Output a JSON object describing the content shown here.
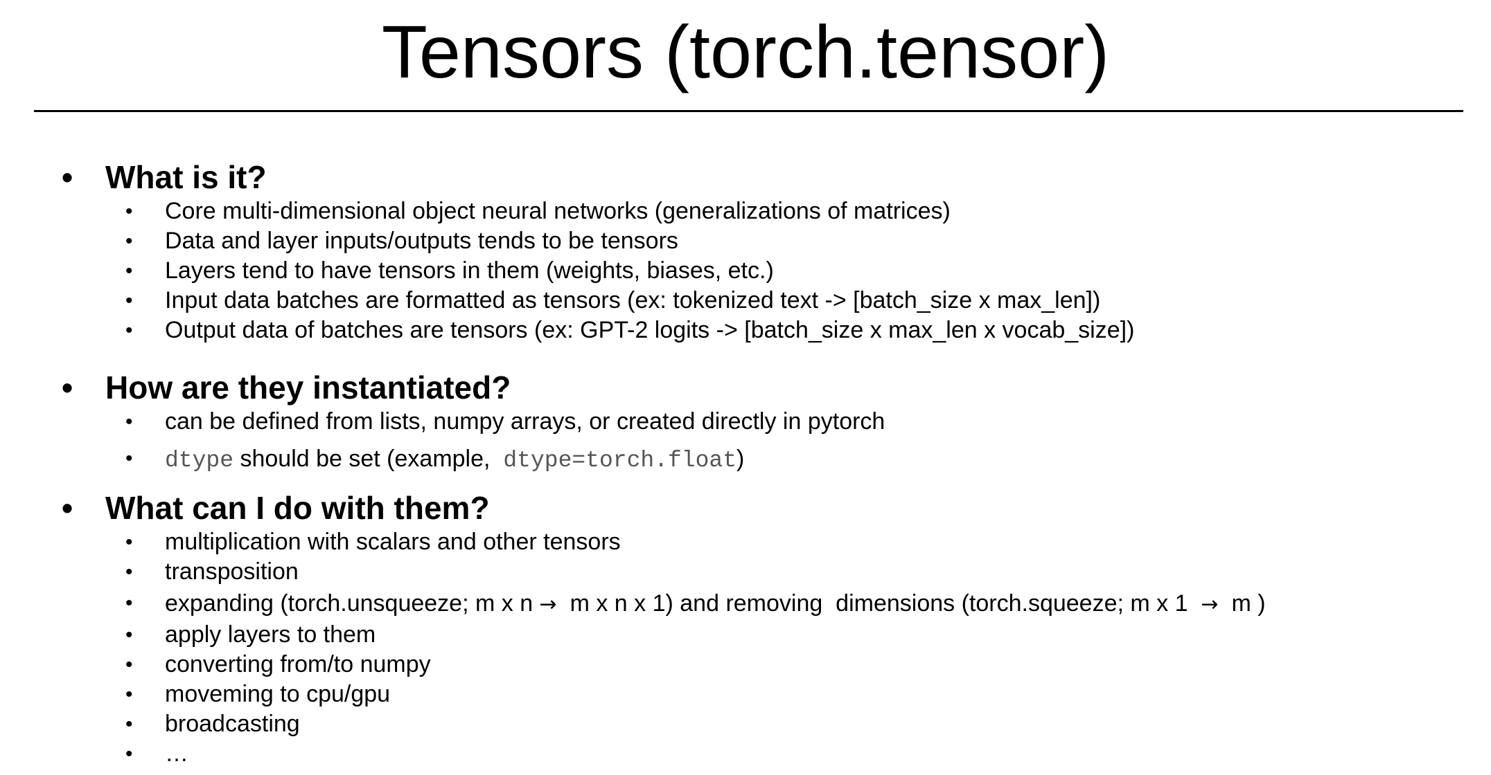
{
  "slide": {
    "title": "Tensors (torch.tensor)",
    "sections": [
      {
        "heading": "What is it?",
        "items": [
          "Core multi-dimensional object  neural networks (generalizations of matrices)",
          "Data and layer inputs/outputs tends to be tensors",
          "Layers tend to have tensors in them (weights, biases, etc.)",
          "Input data batches are formatted as tensors (ex: tokenized text -> [batch_size x max_len])",
          "Output data of batches are tensors (ex: GPT-2 logits -> [batch_size x max_len x vocab_size])"
        ]
      },
      {
        "heading": "How are they instantiated?",
        "items": [
          "can be defined from lists, numpy arrays, or created directly in pytorch"
        ],
        "dtype_item": {
          "code1": "dtype",
          "text1": " should be set (example,  ",
          "code2": "dtype=torch.float",
          "text2": ")"
        }
      },
      {
        "heading": "What can I do with them?",
        "items_before": [
          "multiplication with scalars and other tensors",
          "transposition"
        ],
        "expand_item": {
          "part1": "expanding (torch.unsqueeze; m x n ",
          "arrow1": "→",
          "part2": "  m x n x 1) and removing  dimensions (torch.squeeze; m x 1  ",
          "arrow2": "→",
          "part3": "  m )"
        },
        "items_after": [
          "apply layers to them",
          "converting from/to numpy",
          "moveming to cpu/gpu",
          "broadcasting",
          "…"
        ]
      }
    ],
    "bullet": "•"
  }
}
